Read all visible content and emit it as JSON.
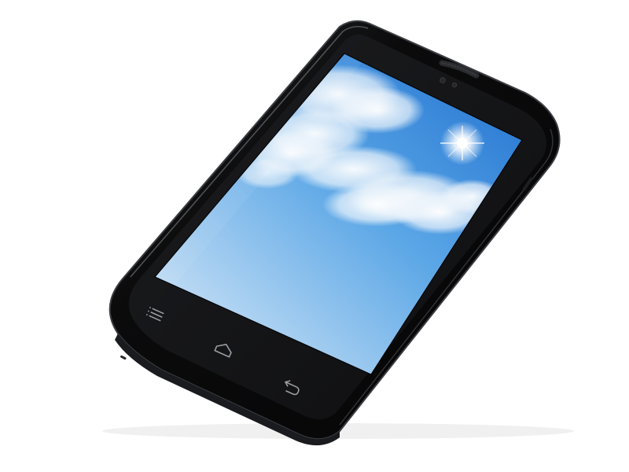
{
  "photo": {
    "subject": "smartphone-product-photo",
    "background_color": "#ffffff"
  },
  "device": {
    "body_color": "#0b0b0c",
    "bezel_color": "#141416",
    "edge_highlight_color": "#5b5d62",
    "speaker_color": "#2a2b2f"
  },
  "screen": {
    "wallpaper": "sky-with-clouds-and-sun",
    "sky_top_color": "#1f6fcf",
    "sky_mid_color": "#5aa6e6",
    "sky_bottom_color": "#dcebf8",
    "cloud_color": "#f4f8fc",
    "sun_color": "#ffffff"
  },
  "nav_buttons": [
    {
      "icon": "menu-icon"
    },
    {
      "icon": "home-icon"
    },
    {
      "icon": "back-icon"
    }
  ]
}
